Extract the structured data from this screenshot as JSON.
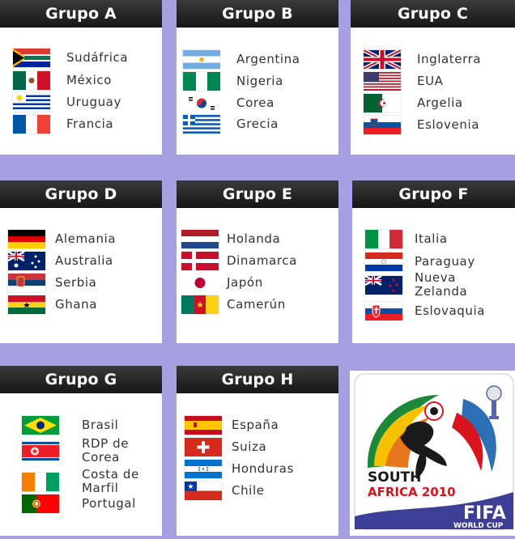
{
  "groups": [
    {
      "title": "Grupo A",
      "teams": [
        {
          "name": "Sudáfrica",
          "flag": "south-africa-flag"
        },
        {
          "name": "México",
          "flag": "mexico-flag"
        },
        {
          "name": "Uruguay",
          "flag": "uruguay-flag"
        },
        {
          "name": "Francia",
          "flag": "france-flag"
        }
      ]
    },
    {
      "title": "Grupo B",
      "teams": [
        {
          "name": "Argentina",
          "flag": "argentina-flag"
        },
        {
          "name": "Nigeria",
          "flag": "nigeria-flag"
        },
        {
          "name": "Corea",
          "flag": "korea-flag"
        },
        {
          "name": "Grecia",
          "flag": "greece-flag"
        }
      ]
    },
    {
      "title": "Grupo C",
      "teams": [
        {
          "name": "Inglaterra",
          "flag": "england-flag"
        },
        {
          "name": "EUA",
          "flag": "usa-flag"
        },
        {
          "name": "Argelia",
          "flag": "algeria-flag"
        },
        {
          "name": "Eslovenia",
          "flag": "slovenia-flag"
        }
      ]
    },
    {
      "title": "Grupo D",
      "teams": [
        {
          "name": "Alemania",
          "flag": "germany-flag"
        },
        {
          "name": "Australia",
          "flag": "australia-flag"
        },
        {
          "name": "Serbia",
          "flag": "serbia-flag"
        },
        {
          "name": "Ghana",
          "flag": "ghana-flag"
        }
      ]
    },
    {
      "title": "Grupo E",
      "teams": [
        {
          "name": "Holanda",
          "flag": "netherlands-flag"
        },
        {
          "name": "Dinamarca",
          "flag": "denmark-flag"
        },
        {
          "name": "Japón",
          "flag": "japan-flag"
        },
        {
          "name": "Camerún",
          "flag": "cameroon-flag"
        }
      ]
    },
    {
      "title": "Grupo F",
      "teams": [
        {
          "name": "Italia",
          "flag": "italy-flag"
        },
        {
          "name": "Paraguay",
          "flag": "paraguay-flag"
        },
        {
          "name": "Nueva Zelanda",
          "flag": "new-zealand-flag"
        },
        {
          "name": "Eslovaquia",
          "flag": "slovakia-flag"
        }
      ]
    },
    {
      "title": "Grupo G",
      "teams": [
        {
          "name": "Brasil",
          "flag": "brazil-flag"
        },
        {
          "name": "RDP de Corea",
          "flag": "north-korea-flag"
        },
        {
          "name": "Costa de Marfil",
          "flag": "ivory-coast-flag"
        },
        {
          "name": "Portugal",
          "flag": "portugal-flag"
        }
      ]
    },
    {
      "title": "Grupo H",
      "teams": [
        {
          "name": "España",
          "flag": "spain-flag"
        },
        {
          "name": "Suiza",
          "flag": "switzerland-flag"
        },
        {
          "name": "Honduras",
          "flag": "honduras-flag"
        },
        {
          "name": "Chile",
          "flag": "chile-flag"
        }
      ]
    }
  ],
  "logo": {
    "line1": "SOUTH",
    "line2": "AFRICA 2010",
    "fifa": "FIFA",
    "sub": "WORLD CUP"
  },
  "colors": {
    "background": "#a6a0e2",
    "header": "#1f1f1f",
    "text": "#333333"
  }
}
